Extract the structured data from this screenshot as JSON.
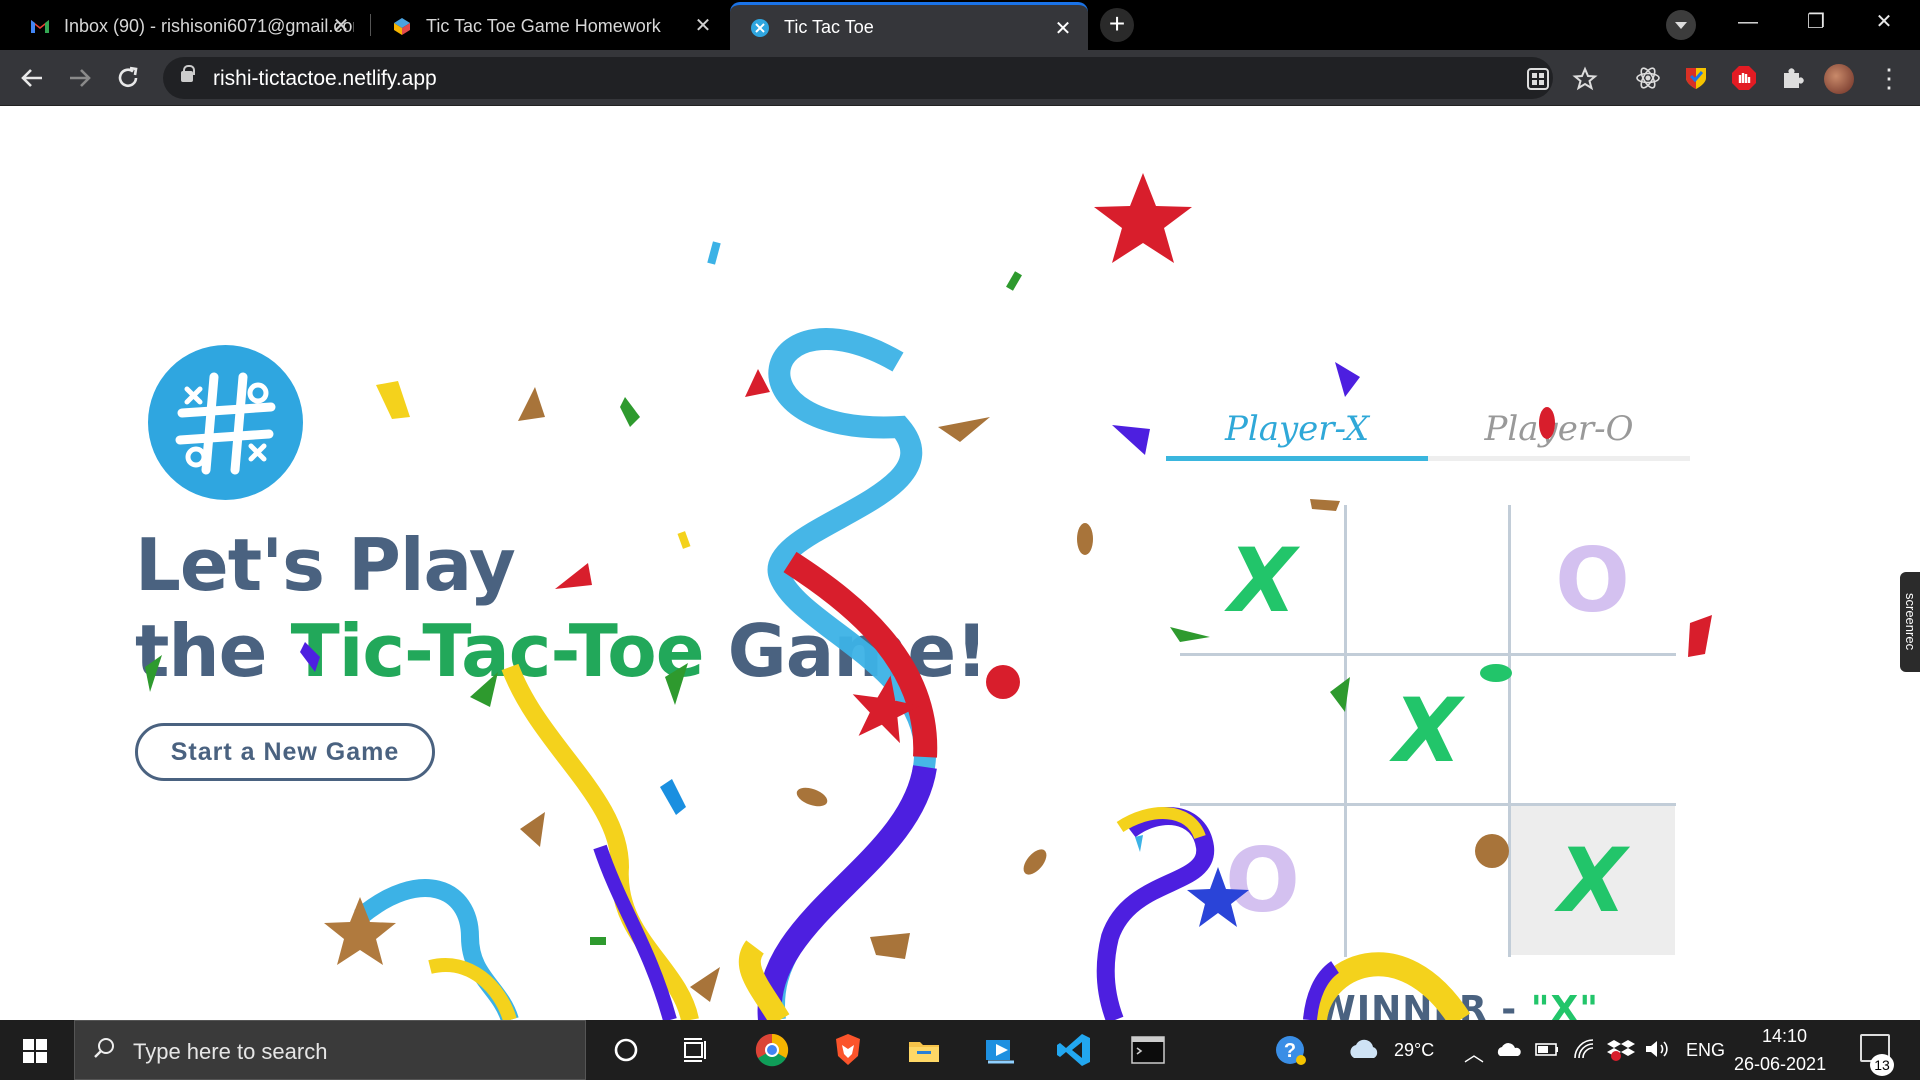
{
  "tabs": [
    {
      "title": "Inbox (90) - rishisoni6071@gmail.com",
      "icon": "gmail-icon"
    },
    {
      "title": "Tic Tac Toe Game Homework",
      "icon": "codepen-icon"
    },
    {
      "title": "Tic Tac Toe",
      "icon": "netlify-icon"
    }
  ],
  "tab_close": "✕",
  "new_tab": "+",
  "window_controls": {
    "minimize": "—",
    "restore": "❐",
    "close": "✕"
  },
  "address_bar": {
    "url": "rishi-tictactoe.netlify.app"
  },
  "hero": {
    "line1": "Let's Play",
    "line2_prefix": "the ",
    "line2_highlight": "Tic-Tac-Toe",
    "line2_suffix": " Game!",
    "start_button": "Start a New Game"
  },
  "players": {
    "x": "Player-X",
    "o": "Player-O"
  },
  "board": {
    "cells": [
      "X",
      "",
      "O",
      "",
      "X",
      "",
      "O",
      "",
      "X"
    ],
    "winning_cell": 8
  },
  "result": {
    "prefix": "WINNER - ",
    "value": "\"X\""
  },
  "screenrec_label": "screenrec",
  "taskbar": {
    "search_placeholder": "Type here to search",
    "weather": "29°C",
    "language": "ENG",
    "time": "14:10",
    "date": "26-06-2021",
    "notifications": "13"
  },
  "colors": {
    "accent_blue": "#2fa6e0",
    "heading": "#4a6280",
    "green": "#22a85a",
    "x_mark": "#22c56a",
    "o_mark": "#d4c1f0"
  }
}
